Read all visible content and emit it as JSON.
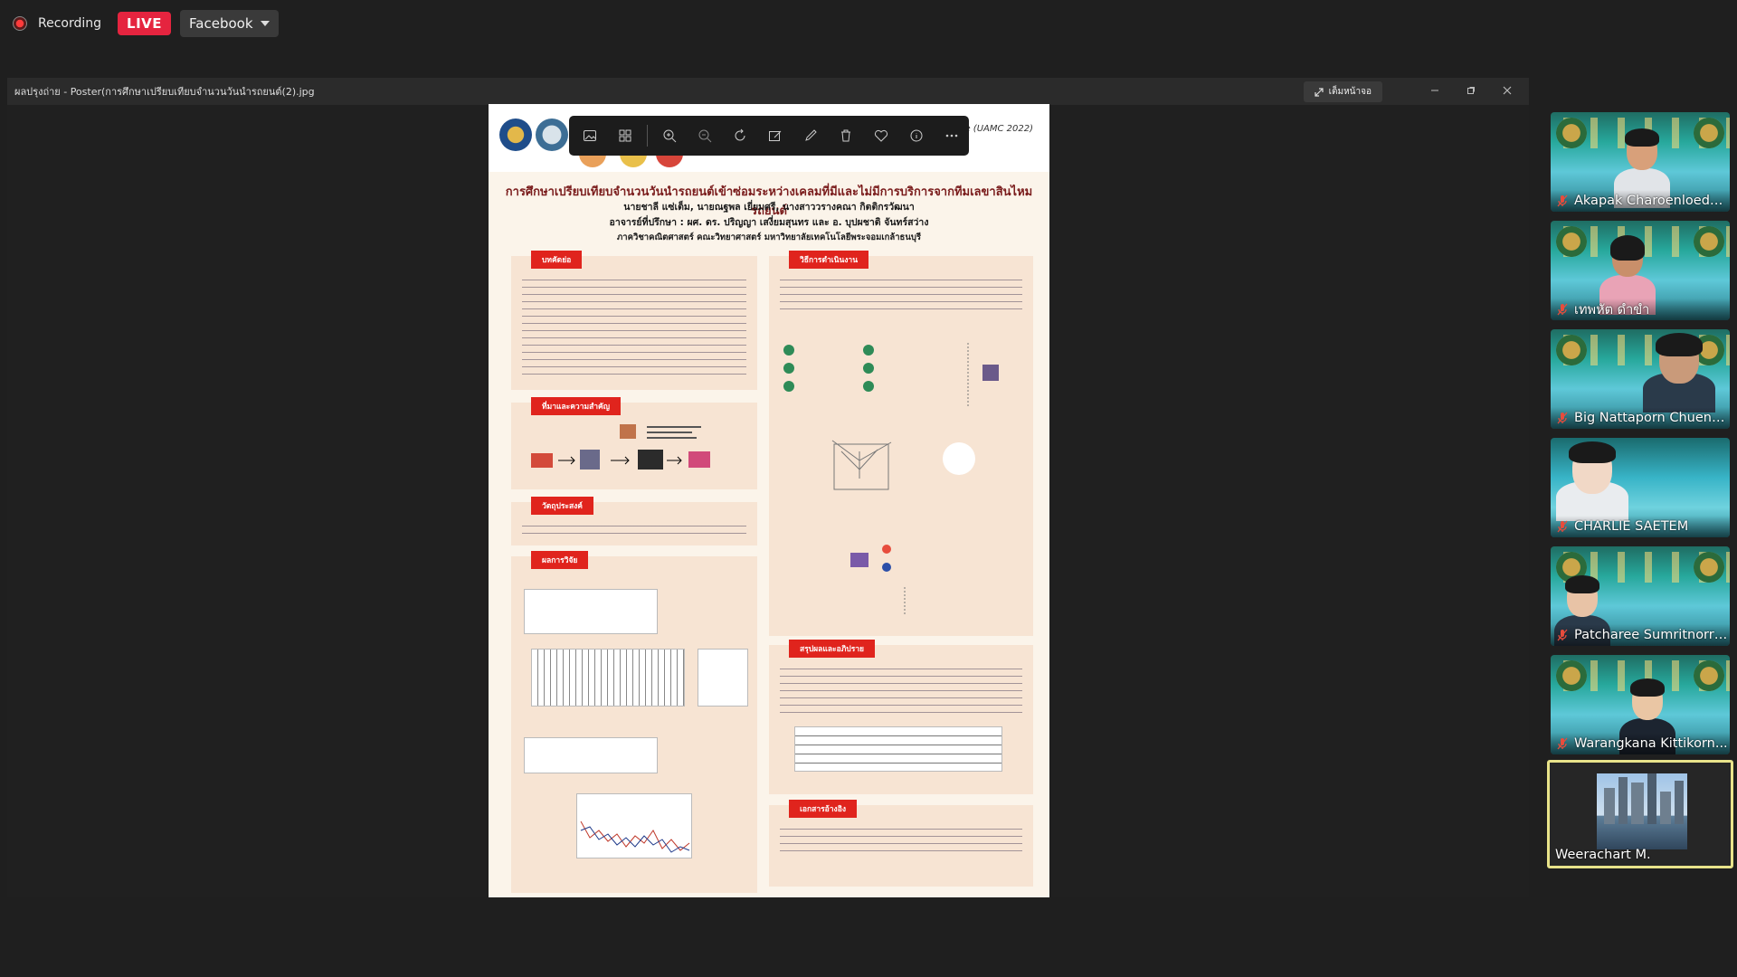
{
  "meeting": {
    "recording_label": "Recording",
    "live_label": "LIVE",
    "stream_target": "Facebook"
  },
  "share_window": {
    "title": "ผลปรุงถ่าย - Poster(การศึกษาเปรียบเทียบจำนวนวันนำรถยนต์(2).jpg",
    "restore_label": "เต็มหน้าจอ"
  },
  "poster": {
    "conference": "ce (UAMC 2022)",
    "title": "การศึกษาเปรียบเทียบจำนวนวันนำรถยนต์เข้าซ่อมระหว่างเคลมที่มีและไม่มีการบริการจากทีมเลขาสินไหมรถยนต์",
    "authors": "นายชาลี แซ่เต็ม, นายณฐพล เยี่ยมศรี, นางสาววรางคณา กิตติกรวัฒนา",
    "advisors": "อาจารย์ที่ปรึกษา : ผศ. ดร. ปริญญา เสงี่ยมสุนทร และ อ. บุปผชาติ จันทร์สว่าง",
    "department": "ภาควิชาคณิตศาสตร์ คณะวิทยาศาสตร์ มหาวิทยาลัยเทคโนโลยีพระจอมเกล้าธนบุรี",
    "sections": {
      "abstract": "บทคัดย่อ",
      "background": "ที่มาและความสำคัญ",
      "objectives": "วัตถุประสงค์",
      "results": "ผลการวิจัย",
      "methods": "วิธีการดำเนินงาน",
      "conclusion": "สรุปผลและอภิปราย",
      "references": "เอกสารอ้างอิง"
    }
  },
  "participants": [
    {
      "name": "Akapak Charoenloedm...",
      "muted": true
    },
    {
      "name": "เทพหัต ดำขำ",
      "muted": true
    },
    {
      "name": "Big Nattaporn Chuenja...",
      "muted": true
    },
    {
      "name": "CHARLIE SAETEM",
      "muted": true
    },
    {
      "name": "Patcharee Sumritnorra...",
      "muted": true
    },
    {
      "name": "Warangkana Kittikorn...",
      "muted": true
    },
    {
      "name": "Weerachart M.",
      "muted": false,
      "active": true
    }
  ],
  "colors": {
    "live_badge": "#e5243f",
    "poster_section_header": "#e0241d",
    "active_speaker_border": "#e8e38a"
  }
}
